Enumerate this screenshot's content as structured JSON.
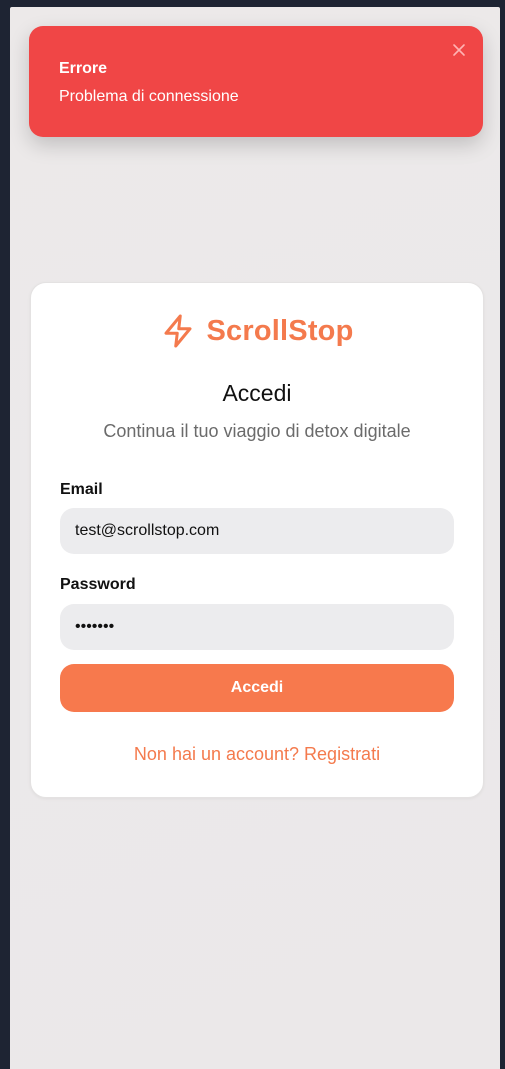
{
  "toast": {
    "title": "Errore",
    "message": "Problema di connessione",
    "close_icon": "close-icon",
    "color": "#f04646"
  },
  "brand": {
    "name": "ScrollStop",
    "icon": "lightning-bolt-icon",
    "color": "#f47a4d"
  },
  "login": {
    "heading": "Accedi",
    "subheading": "Continua il tuo viaggio di detox digitale",
    "email_label": "Email",
    "email_value": "test@scrollstop.com",
    "password_label": "Password",
    "password_value": "1234567",
    "submit_label": "Accedi",
    "register_link": "Non hai un account? Registrati",
    "accent_color": "#f7794d"
  }
}
